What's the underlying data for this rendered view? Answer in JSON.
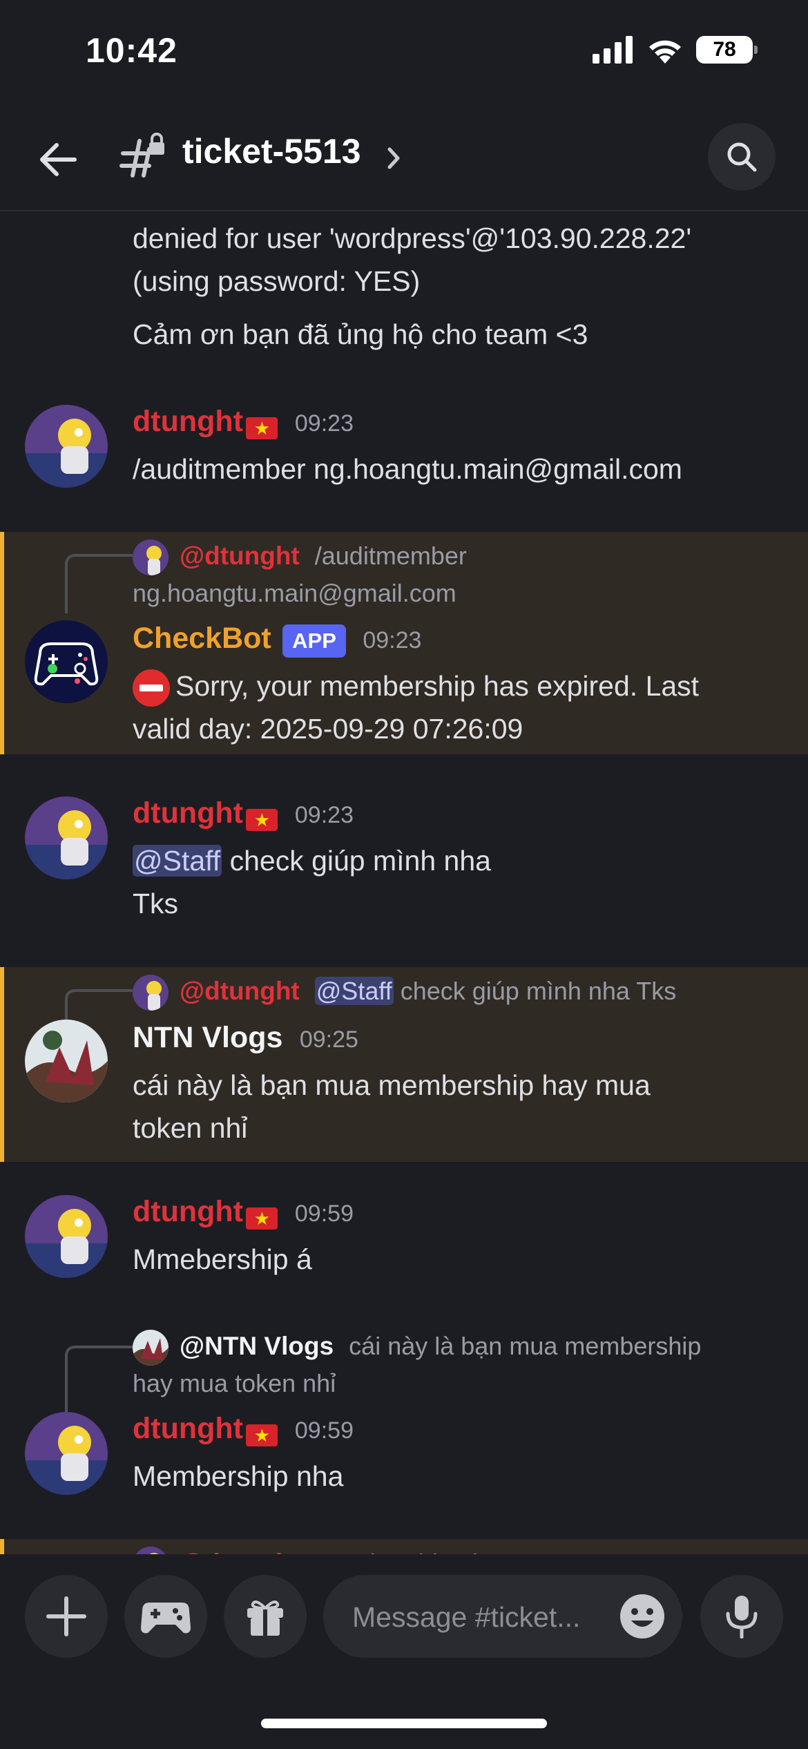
{
  "status_bar": {
    "time": "10:42",
    "battery": "78"
  },
  "header": {
    "channel_name": "ticket-5513"
  },
  "messages": {
    "m0": {
      "line1": "denied for user 'wordpress'@'103.90.228.22'",
      "line2": "(using password: YES)",
      "line3": "Cảm ơn bạn đã ủng hộ cho team <3"
    },
    "m1": {
      "author": "dtunght",
      "time": "09:23",
      "text": "/auditmember ng.hoangtu.main@gmail.com"
    },
    "m2": {
      "reply_author": "@dtunght",
      "reply_text_1": "/auditmember",
      "reply_text_2": "ng.hoangtu.main@gmail.com",
      "author": "CheckBot",
      "badge": "APP",
      "time": "09:23",
      "line1": "Sorry, your membership has expired. Last",
      "line2": "valid day: 2025-09-29 07:26:09"
    },
    "m3": {
      "author": "dtunght",
      "time": "09:23",
      "mention": "@Staff",
      "line1": " check giúp mình nha",
      "line2": "Tks"
    },
    "m4": {
      "reply_author": "@dtunght",
      "reply_mention": "@Staff",
      "reply_text": " check giúp mình nha Tks",
      "author": "NTN Vlogs",
      "time": "09:25",
      "line1": "cái này là bạn mua membership hay mua",
      "line2": "token nhỉ"
    },
    "m5": {
      "author": "dtunght",
      "time": "09:59",
      "text": "Mmebership á"
    },
    "m6": {
      "reply_author": "@NTN Vlogs",
      "reply_text_1": "cái này là bạn mua membership",
      "reply_text_2": "hay mua token nhỉ",
      "author": "dtunght",
      "time": "09:59",
      "text": "Membership nha"
    },
    "m7": {
      "reply_author": "@dtunght",
      "reply_text": "Membership nha"
    }
  },
  "composer": {
    "placeholder": "Message #ticket..."
  },
  "colors": {
    "background": "#1c1d22",
    "username_red": "#e0323a",
    "bot_orange": "#f0a12c",
    "app_badge": "#5865f2",
    "highlight_border": "#f0b232"
  }
}
